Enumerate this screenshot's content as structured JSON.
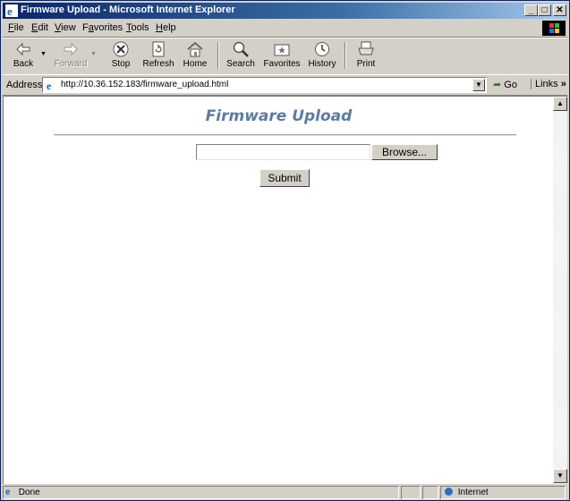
{
  "window": {
    "title": "Firmware Upload - Microsoft Internet Explorer"
  },
  "menu": [
    {
      "label": "File",
      "key": "F"
    },
    {
      "label": "Edit",
      "key": "E"
    },
    {
      "label": "View",
      "key": "V"
    },
    {
      "label": "Favorites",
      "key": "a"
    },
    {
      "label": "Tools",
      "key": "T"
    },
    {
      "label": "Help",
      "key": "H"
    }
  ],
  "toolbar": {
    "back": "Back",
    "forward": "Forward",
    "stop": "Stop",
    "refresh": "Refresh",
    "home": "Home",
    "search": "Search",
    "favorites": "Favorites",
    "history": "History",
    "print": "Print"
  },
  "address": {
    "label": "Address",
    "url": "http://10.36.152.183/firmware_upload.html",
    "go": "Go",
    "links": "Links"
  },
  "page": {
    "heading": "Firmware Upload",
    "file_value": "",
    "browse": "Browse...",
    "submit": "Submit"
  },
  "status": {
    "text": "Done",
    "zone": "Internet"
  },
  "colors": {
    "title_bar": "#0a246a",
    "heading": "#5c7ba3"
  }
}
